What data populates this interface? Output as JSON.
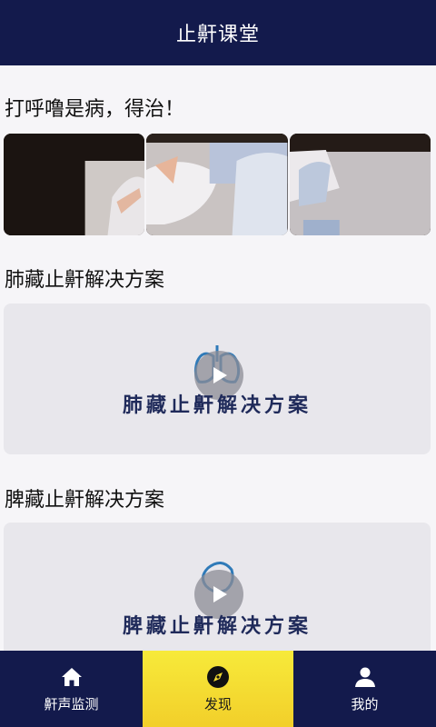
{
  "header": {
    "title": "止鼾课堂"
  },
  "sections": [
    {
      "title": "打呼噜是病，得治！"
    },
    {
      "title": "肺藏止鼾解决方案",
      "card_text": "肺藏止鼾解决方案",
      "icon": "lungs-icon"
    },
    {
      "title": "脾藏止鼾解决方案",
      "card_text": "脾藏止鼾解决方案",
      "icon": "spleen-icon"
    }
  ],
  "tabs": [
    {
      "label": "鼾声监测",
      "icon": "home-icon"
    },
    {
      "label": "发现",
      "icon": "compass-icon",
      "active": true
    },
    {
      "label": "我的",
      "icon": "person-icon"
    }
  ],
  "colors": {
    "header_bg": "#131a4c",
    "tab_active": "#f5dc32",
    "card_text": "#1f2a5a",
    "icon_stroke": "#2f7ab8"
  }
}
